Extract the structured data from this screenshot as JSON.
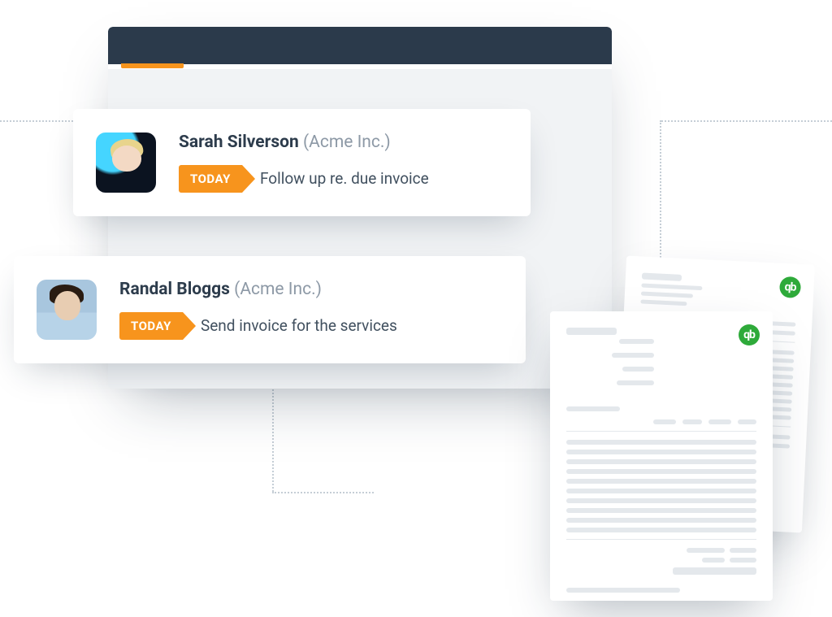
{
  "colors": {
    "accent": "#f7941d",
    "titlebar": "#2b3a4b",
    "qb": "#2eaa3a"
  },
  "badge_label": "TODAY",
  "qb_label": "qb",
  "tasks": [
    {
      "name": "Sarah Silverson",
      "company": "(Acme Inc.)",
      "description": "Follow up re. due invoice"
    },
    {
      "name": "Randal Bloggs",
      "company": "(Acme Inc.)",
      "description": "Send invoice for the services"
    }
  ]
}
